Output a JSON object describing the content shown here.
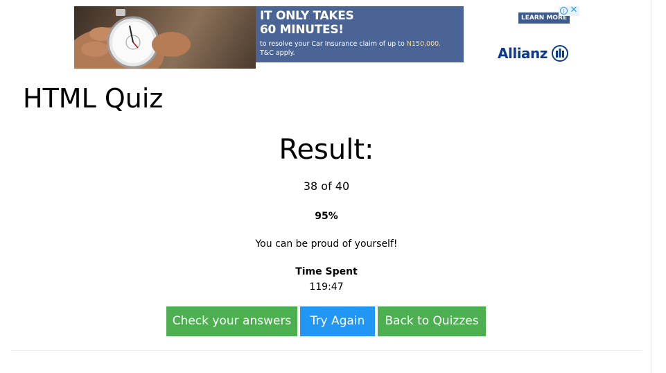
{
  "ad": {
    "headline_line1": "IT ONLY TAKES",
    "headline_line2": "60 MINUTES!",
    "sub_part1": "to resolve your Car Insurance claim of up to ",
    "sub_highlight": "N150,000.",
    "sub_line2": "T&C apply.",
    "learn_more": "LEARN MORE",
    "brand": "Allianz",
    "info_icon": "info-icon",
    "close_icon": "close-icon",
    "colors": {
      "panel": "#4a6595",
      "brand": "#0a3a8c",
      "highlight": "#ffd98a"
    }
  },
  "quiz": {
    "title": "HTML Quiz",
    "result_heading": "Result:",
    "score": "38 of 40",
    "percent": "95%",
    "message": "You can be proud of yourself!",
    "time_label": "Time Spent",
    "time_value": "119:47"
  },
  "buttons": {
    "check_answers": "Check your answers",
    "try_again": "Try Again",
    "back_to_quizzes": "Back to Quizzes",
    "colors": {
      "green": "#4caf50",
      "blue": "#2196f3"
    }
  }
}
